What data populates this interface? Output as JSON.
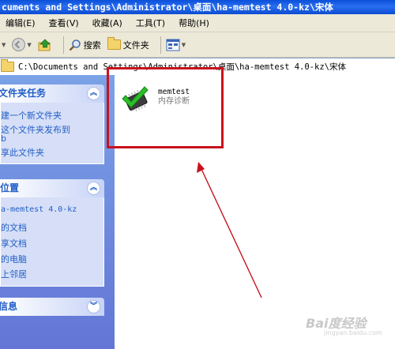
{
  "window": {
    "title": "cuments and Settings\\Administrator\\桌面\\ha-memtest 4.0-kz\\宋体"
  },
  "menu": [
    "编辑(E)",
    "查看(V)",
    "收藏(A)",
    "工具(T)",
    "帮助(H)"
  ],
  "toolbar": {
    "search_label": "搜索",
    "folders_label": "文件夹"
  },
  "address": {
    "path": "C:\\Documents and Settings\\Administrator\\桌面\\ha-memtest 4.0-kz\\宋体"
  },
  "left_pane": {
    "file_tasks": {
      "title": "文件夹任务",
      "items": [
        "建一个新文件夹",
        "这个文件夹发布到",
        "b",
        "享此文件夹"
      ]
    },
    "other_places": {
      "title": "位置",
      "items": [
        "a-memtest 4.0-kz",
        "的文档",
        "享文档",
        "的电脑",
        "上邻居"
      ]
    },
    "details": {
      "title": "信息"
    }
  },
  "content": {
    "file": {
      "name": "memtest",
      "description": "内存诊断",
      "icon": "memtest-chip-checkmark-icon"
    }
  },
  "annotation": {
    "box_color": "#c8121c",
    "arrow_color": "#c8121c"
  },
  "watermark": {
    "text": "Bai度经验",
    "subtext": "jingyan.baidu.com"
  }
}
